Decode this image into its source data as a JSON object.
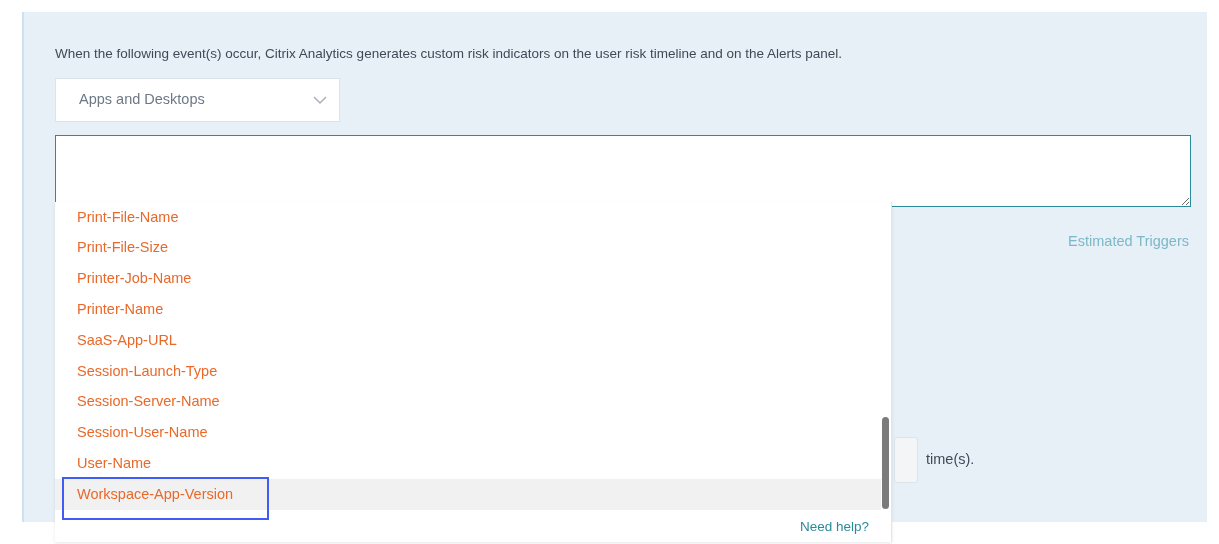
{
  "description": "When the following event(s) occur, Citrix Analytics generates custom risk indicators on the user risk timeline and on the Alerts panel.",
  "source_select": {
    "value": "Apps and Desktops"
  },
  "estimated_triggers": "Estimated Triggers",
  "count_suffix": "time(s).",
  "suggestions": {
    "items": [
      {
        "label": "Print-File-Name",
        "selected": false,
        "annotated": false
      },
      {
        "label": "Print-File-Size",
        "selected": false,
        "annotated": false
      },
      {
        "label": "Printer-Job-Name",
        "selected": false,
        "annotated": false
      },
      {
        "label": "Printer-Name",
        "selected": false,
        "annotated": false
      },
      {
        "label": "SaaS-App-URL",
        "selected": false,
        "annotated": false
      },
      {
        "label": "Session-Launch-Type",
        "selected": false,
        "annotated": false
      },
      {
        "label": "Session-Server-Name",
        "selected": false,
        "annotated": false
      },
      {
        "label": "Session-User-Name",
        "selected": false,
        "annotated": false
      },
      {
        "label": "User-Name",
        "selected": false,
        "annotated": false
      },
      {
        "label": "Workspace-App-Version",
        "selected": true,
        "annotated": true
      }
    ],
    "help_link": "Need help?"
  }
}
